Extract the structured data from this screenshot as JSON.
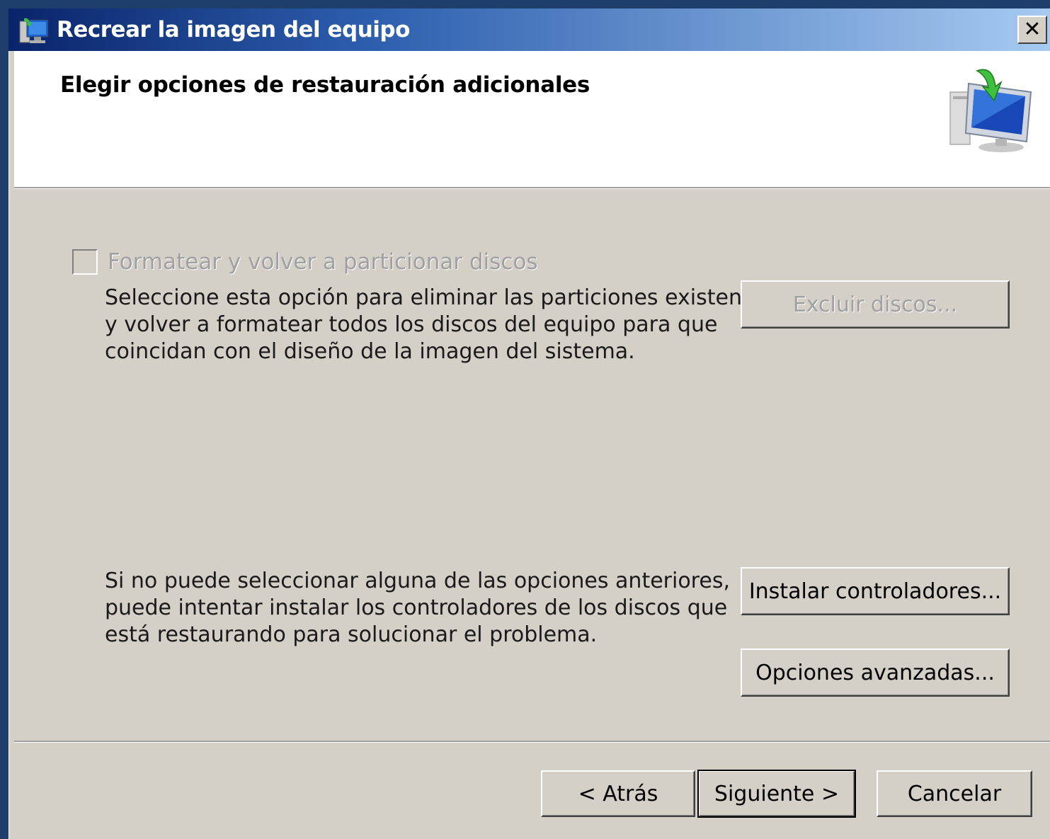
{
  "window": {
    "title": "Recrear la imagen del equipo",
    "close_glyph": "✕"
  },
  "header": {
    "title": "Elegir opciones de restauración adicionales",
    "icon": "computer-restore-icon"
  },
  "format_option": {
    "checkbox_label": "Formatear y volver a particionar discos",
    "checked": false,
    "enabled": false,
    "description_lines": [
      "Seleccione esta opción para eliminar las particiones existentes",
      "y volver a formatear todos los discos del equipo para que",
      "coincidan con el diseño de la imagen del sistema."
    ],
    "exclude_button": "Excluir discos..."
  },
  "drivers": {
    "description_lines": [
      "Si no puede seleccionar alguna de las opciones anteriores,",
      "puede intentar instalar los controladores de los discos que",
      "está restaurando para solucionar el problema."
    ],
    "install_button": "Instalar controladores...",
    "advanced_button": "Opciones avanzadas..."
  },
  "footer": {
    "back_button": "< Atrás",
    "next_button": "Siguiente >",
    "cancel_button": "Cancelar"
  },
  "colors": {
    "titlebar_start": "#0a246a",
    "titlebar_end": "#a6caf0",
    "dialog_face": "#d4d0c8",
    "disabled_text": "#a0a0a0"
  }
}
